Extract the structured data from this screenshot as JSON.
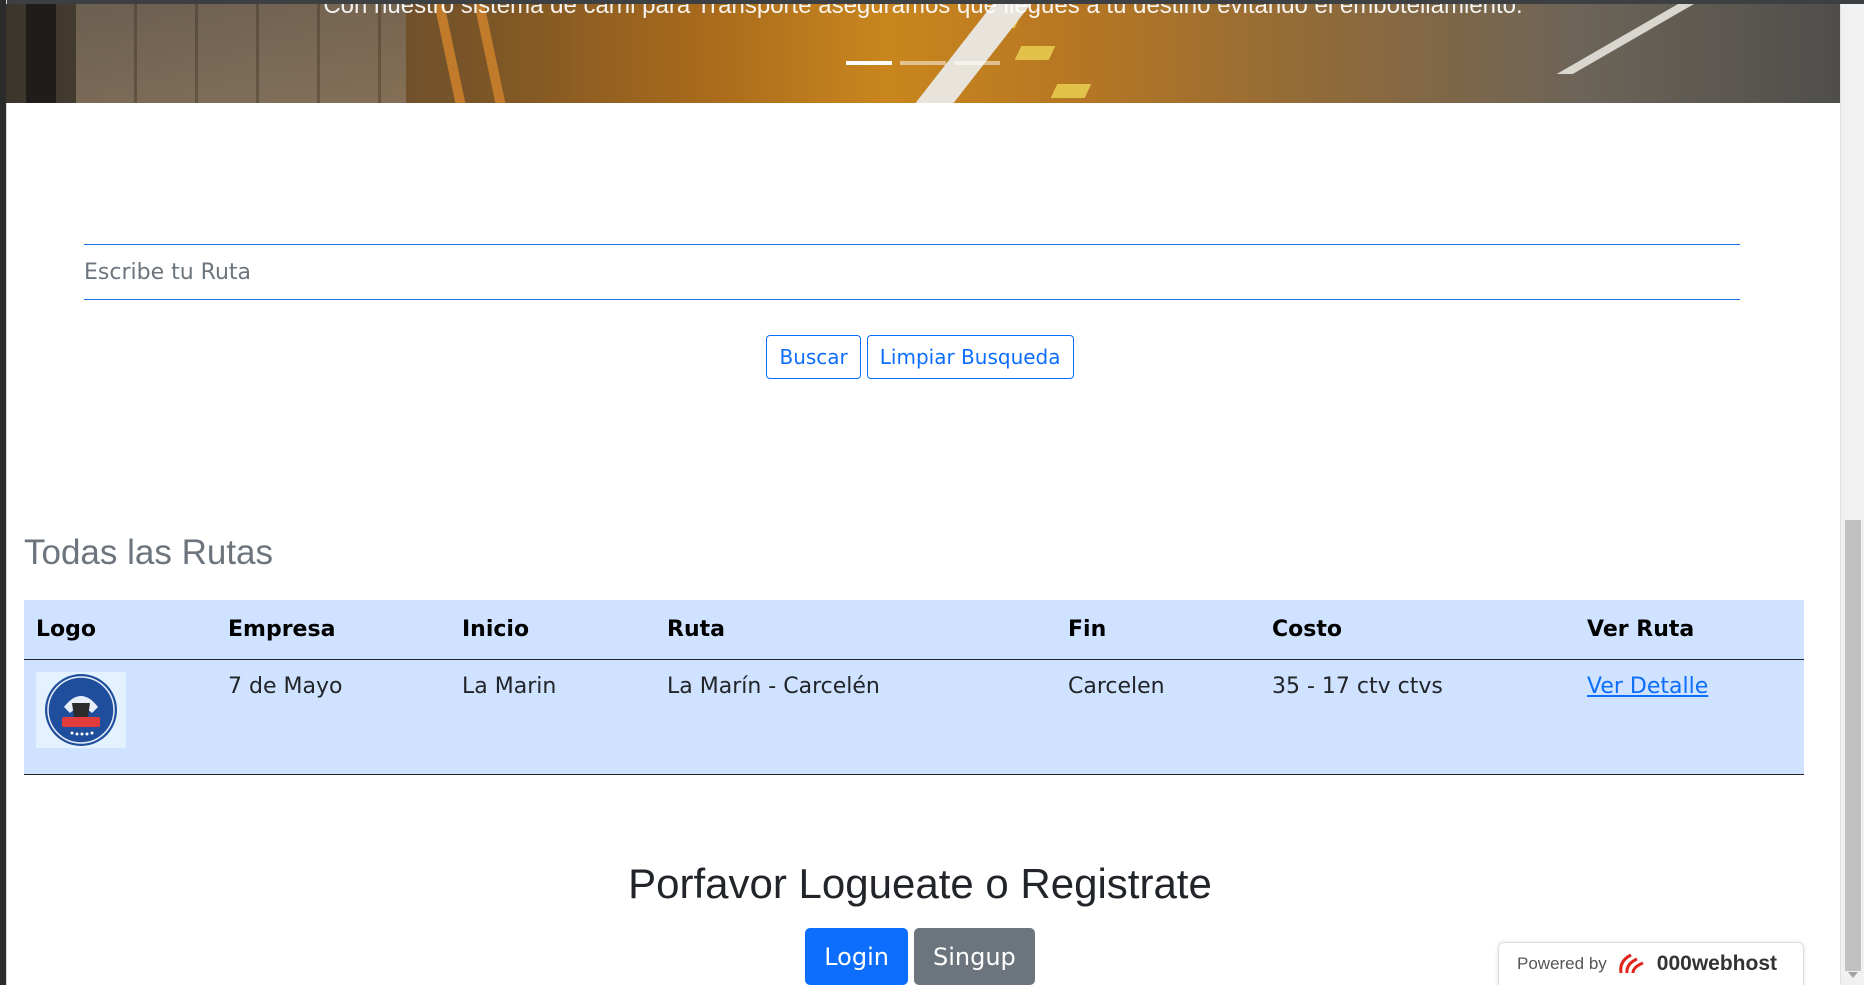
{
  "hero": {
    "caption": "Con nuestro sistema de carril para Transporte aseguramos que llegues a tu destino evitando el embotellamiento."
  },
  "search": {
    "placeholder": "Escribe tu Ruta",
    "buscar_label": "Buscar",
    "limpiar_label": "Limpiar Busqueda"
  },
  "routes": {
    "title": "Todas las Rutas",
    "columns": [
      "Logo",
      "Empresa",
      "Inicio",
      "Ruta",
      "Fin",
      "Costo",
      "Ver Ruta"
    ],
    "rows": [
      {
        "logo": "7 de mayo logo",
        "empresa": "7 de Mayo",
        "inicio": "La Marin",
        "ruta": "La Marín - Carcelén",
        "fin": "Carcelen",
        "costo": "35 - 17 ctv ctvs",
        "ver": "Ver Detalle"
      }
    ]
  },
  "auth": {
    "prompt": "Porfavor Logueate o Registrate",
    "login_label": "Login",
    "signup_label": "Singup"
  },
  "footer_badge": {
    "powered": "Powered by",
    "brand": "000webhost"
  }
}
